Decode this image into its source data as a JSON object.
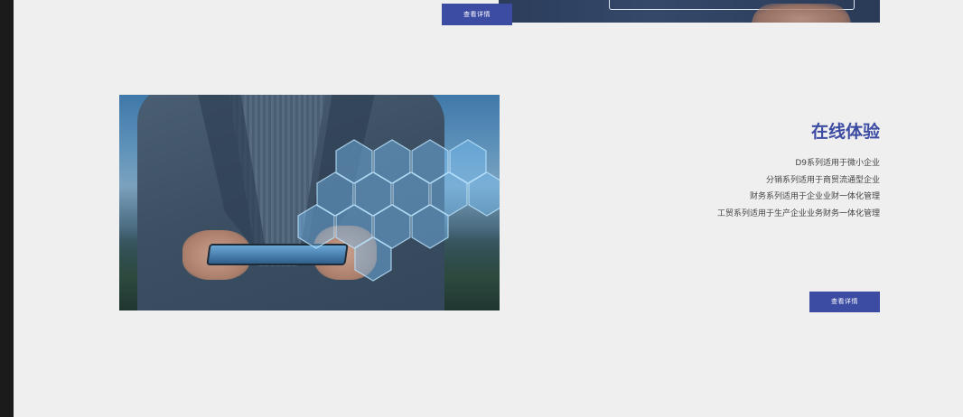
{
  "top_section": {
    "button_label": "查看详情"
  },
  "section": {
    "title": "在线体验",
    "features": [
      "D9系列适用于微小企业",
      "分销系列适用于商贸流通型企业",
      "财务系列适用于企业业财一体化管理",
      "工贸系列适用于生产企业业务财务一体化管理"
    ],
    "button_label": "查看详情"
  },
  "colors": {
    "accent": "#3d4ca3",
    "background": "#efefef"
  }
}
